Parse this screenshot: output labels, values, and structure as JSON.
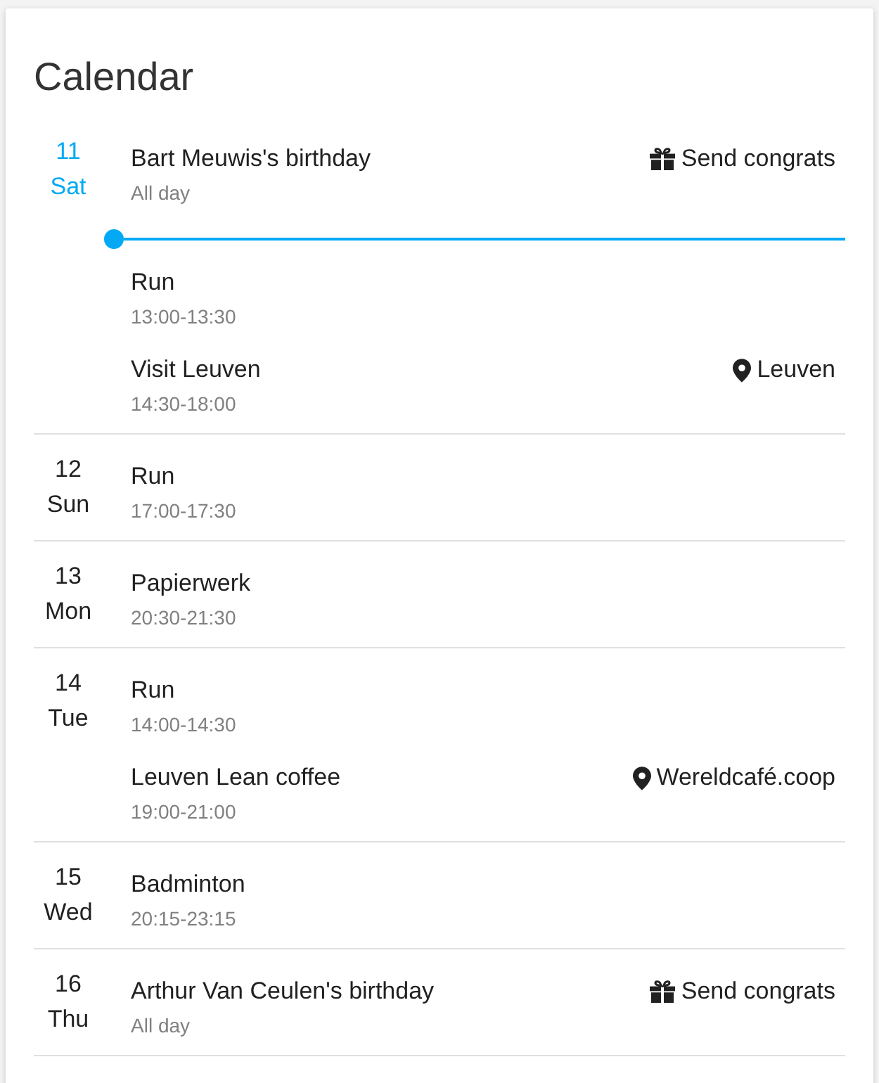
{
  "card": {
    "title": "Calendar"
  },
  "days": [
    {
      "number": "11",
      "weekday": "Sat",
      "today": true,
      "entries": [
        {
          "kind": "event",
          "title": "Bart Meuwis's birthday",
          "time": "All day",
          "action": {
            "kind": "gift",
            "label": "Send congrats"
          }
        },
        {
          "kind": "now-marker"
        },
        {
          "kind": "event",
          "title": "Run",
          "time": "13:00-13:30"
        },
        {
          "kind": "event",
          "title": "Visit Leuven",
          "time": "14:30-18:00",
          "action": {
            "kind": "location",
            "label": "Leuven"
          }
        }
      ]
    },
    {
      "number": "12",
      "weekday": "Sun",
      "today": false,
      "entries": [
        {
          "kind": "event",
          "title": "Run",
          "time": "17:00-17:30"
        }
      ]
    },
    {
      "number": "13",
      "weekday": "Mon",
      "today": false,
      "entries": [
        {
          "kind": "event",
          "title": "Papierwerk",
          "time": "20:30-21:30"
        }
      ]
    },
    {
      "number": "14",
      "weekday": "Tue",
      "today": false,
      "entries": [
        {
          "kind": "event",
          "title": "Run",
          "time": "14:00-14:30"
        },
        {
          "kind": "event",
          "title": "Leuven Lean coffee",
          "time": "19:00-21:00",
          "action": {
            "kind": "location",
            "label": "Wereldcafé.coop"
          }
        }
      ]
    },
    {
      "number": "15",
      "weekday": "Wed",
      "today": false,
      "entries": [
        {
          "kind": "event",
          "title": "Badminton",
          "time": "20:15-23:15"
        }
      ]
    },
    {
      "number": "16",
      "weekday": "Thu",
      "today": false,
      "entries": [
        {
          "kind": "event",
          "title": "Arthur Van Ceulen's birthday",
          "time": "All day",
          "action": {
            "kind": "gift",
            "label": "Send congrats"
          }
        }
      ]
    }
  ]
}
